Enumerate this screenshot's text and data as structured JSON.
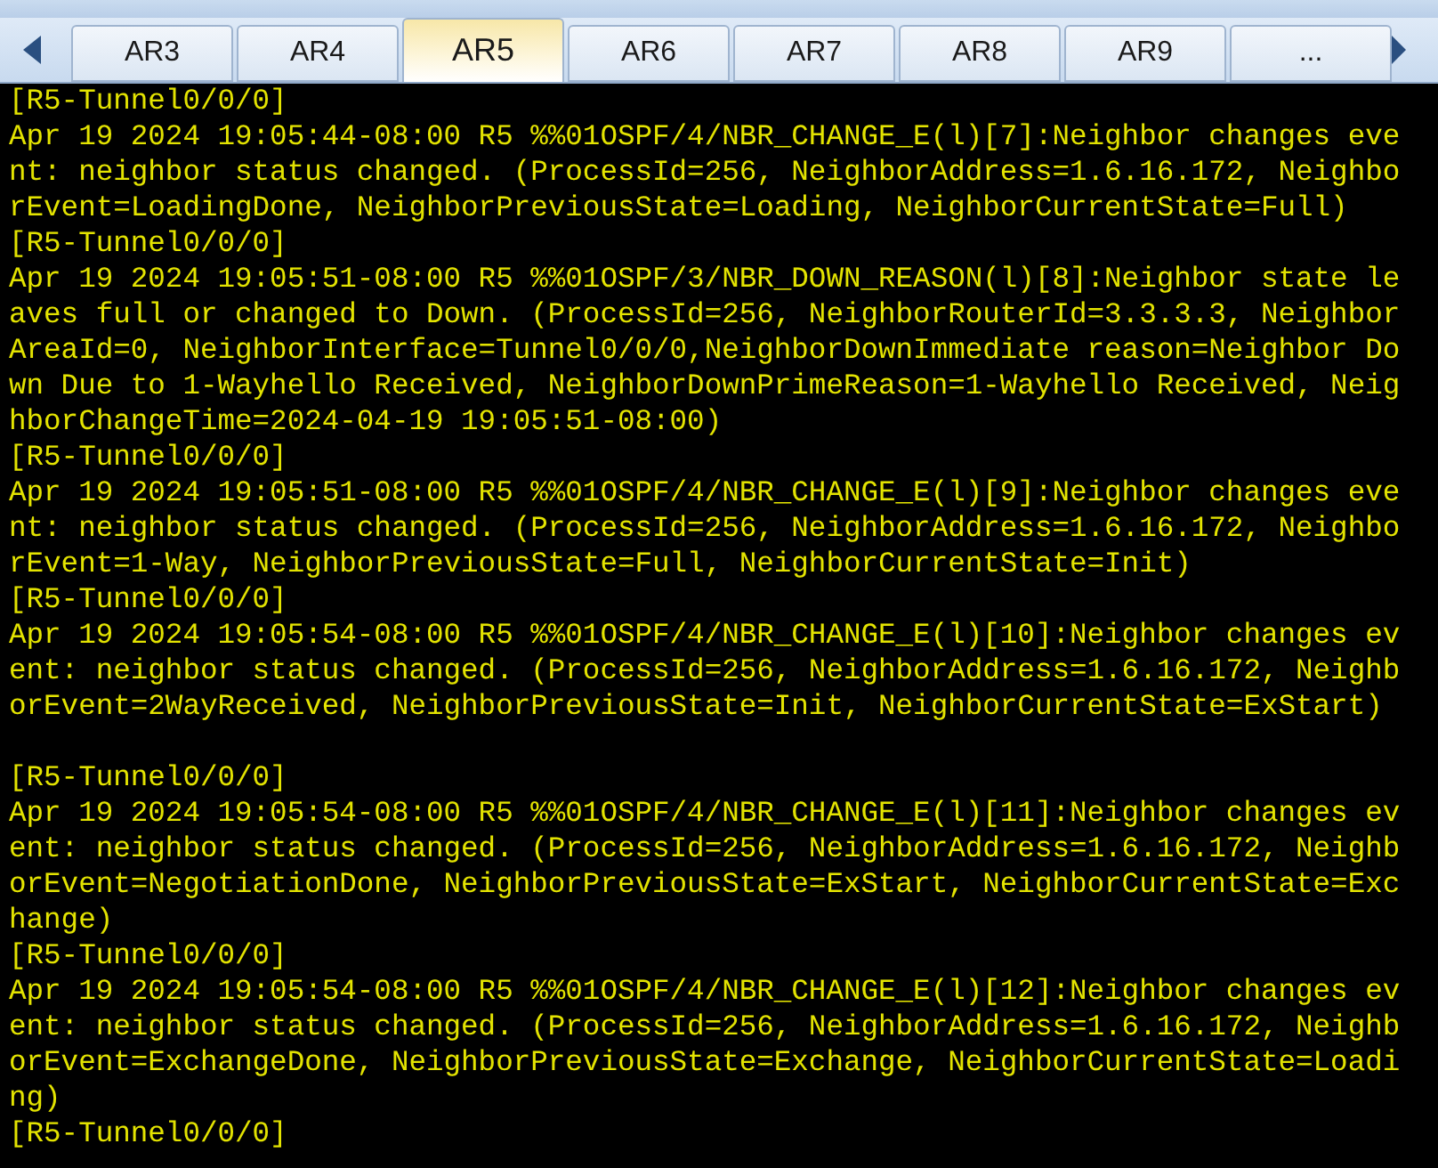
{
  "tabs": [
    {
      "label": "AR3",
      "selected": false
    },
    {
      "label": "AR4",
      "selected": false
    },
    {
      "label": "AR5",
      "selected": true
    },
    {
      "label": "AR6",
      "selected": false
    },
    {
      "label": "AR7",
      "selected": false
    },
    {
      "label": "AR8",
      "selected": false
    },
    {
      "label": "AR9",
      "selected": false
    },
    {
      "label": "...",
      "selected": false
    }
  ],
  "terminal": {
    "lines": [
      {
        "kind": "text",
        "text": "[R5-Tunnel0/0/0]"
      },
      {
        "kind": "text",
        "text": "Apr 19 2024 19:05:44-08:00 R5 %%01OSPF/4/NBR_CHANGE_E(l)[7]:Neighbor changes eve"
      },
      {
        "kind": "text",
        "text": "nt: neighbor status changed. (ProcessId=256, NeighborAddress=1.6.16.172, Neighbo"
      },
      {
        "kind": "text",
        "text": "rEvent=LoadingDone, NeighborPreviousState=Loading, NeighborCurrentState=Full)"
      },
      {
        "kind": "text",
        "text": "[R5-Tunnel0/0/0]"
      },
      {
        "kind": "text",
        "text": "Apr 19 2024 19:05:51-08:00 R5 %%01OSPF/3/NBR_DOWN_REASON(l)[8]:Neighbor state le"
      },
      {
        "kind": "text",
        "text": "aves full or changed to Down. (ProcessId=256, NeighborRouterId=3.3.3.3, Neighbor"
      },
      {
        "kind": "text",
        "text": "AreaId=0, NeighborInterface=Tunnel0/0/0,NeighborDownImmediate reason=Neighbor Do"
      },
      {
        "kind": "text",
        "text": "wn Due to 1-Wayhello Received, NeighborDownPrimeReason=1-Wayhello Received, Neig"
      },
      {
        "kind": "text",
        "text": "hborChangeTime=2024-04-19 19:05:51-08:00)"
      },
      {
        "kind": "text",
        "text": "[R5-Tunnel0/0/0]"
      },
      {
        "kind": "text",
        "text": "Apr 19 2024 19:05:51-08:00 R5 %%01OSPF/4/NBR_CHANGE_E(l)[9]:Neighbor changes eve"
      },
      {
        "kind": "text",
        "text": "nt: neighbor status changed. (ProcessId=256, NeighborAddress=1.6.16.172, Neighbo"
      },
      {
        "kind": "text",
        "text": "rEvent=1-Way, NeighborPreviousState=Full, NeighborCurrentState=Init)"
      },
      {
        "kind": "text",
        "text": "[R5-Tunnel0/0/0]"
      },
      {
        "kind": "text",
        "text": "Apr 19 2024 19:05:54-08:00 R5 %%01OSPF/4/NBR_CHANGE_E(l)[10]:Neighbor changes ev"
      },
      {
        "kind": "text",
        "text": "ent: neighbor status changed. (ProcessId=256, NeighborAddress=1.6.16.172, Neighb"
      },
      {
        "kind": "text",
        "text": "orEvent=2WayReceived, NeighborPreviousState=Init, NeighborCurrentState=ExStart)"
      },
      {
        "kind": "blank"
      },
      {
        "kind": "text",
        "text": "[R5-Tunnel0/0/0]"
      },
      {
        "kind": "text",
        "text": "Apr 19 2024 19:05:54-08:00 R5 %%01OSPF/4/NBR_CHANGE_E(l)[11]:Neighbor changes ev"
      },
      {
        "kind": "text",
        "text": "ent: neighbor status changed. (ProcessId=256, NeighborAddress=1.6.16.172, Neighb"
      },
      {
        "kind": "text",
        "text": "orEvent=NegotiationDone, NeighborPreviousState=ExStart, NeighborCurrentState=Exc"
      },
      {
        "kind": "text",
        "text": "hange)"
      },
      {
        "kind": "text",
        "text": "[R5-Tunnel0/0/0]"
      },
      {
        "kind": "text",
        "text": "Apr 19 2024 19:05:54-08:00 R5 %%01OSPF/4/NBR_CHANGE_E(l)[12]:Neighbor changes ev"
      },
      {
        "kind": "text",
        "text": "ent: neighbor status changed. (ProcessId=256, NeighborAddress=1.6.16.172, Neighb"
      },
      {
        "kind": "text",
        "text": "orEvent=ExchangeDone, NeighborPreviousState=Exchange, NeighborCurrentState=Loadi"
      },
      {
        "kind": "text",
        "text": "ng)"
      },
      {
        "kind": "text",
        "text": "[R5-Tunnel0/0/0]"
      }
    ]
  }
}
